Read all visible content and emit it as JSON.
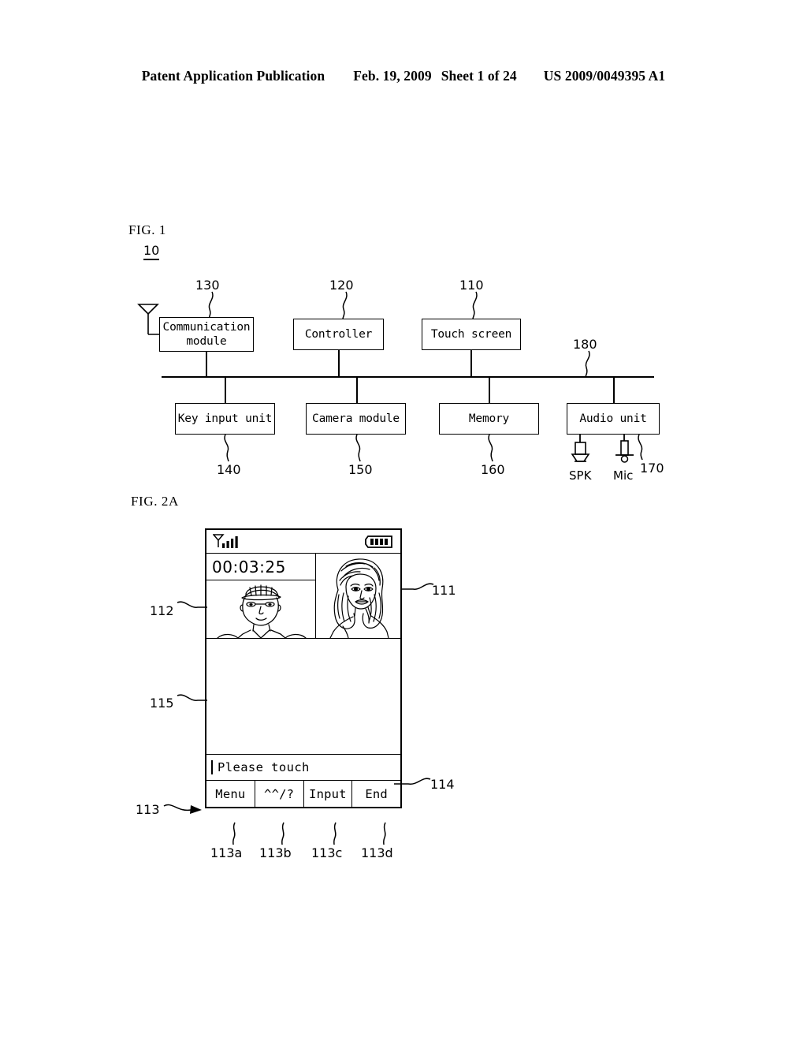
{
  "header": {
    "publication": "Patent Application Publication",
    "date": "Feb. 19, 2009",
    "sheet": "Sheet 1 of 24",
    "patent_number": "US 2009/0049395 A1"
  },
  "fig1": {
    "label": "FIG. 1",
    "device_ref": "10",
    "bus_ref": "180",
    "top_blocks": [
      {
        "ref": "130",
        "label": "Communication\nmodule",
        "line1": "Communication",
        "line2": "module"
      },
      {
        "ref": "120",
        "label": "Controller",
        "line1": "Controller",
        "line2": ""
      },
      {
        "ref": "110",
        "label": "Touch screen",
        "line1": "Touch screen",
        "line2": ""
      }
    ],
    "bottom_blocks": [
      {
        "ref": "140",
        "label": "Key input unit"
      },
      {
        "ref": "150",
        "label": "Camera module"
      },
      {
        "ref": "160",
        "label": "Memory"
      },
      {
        "ref": "170",
        "label": "Audio unit"
      }
    ],
    "audio_peripherals": [
      {
        "name": "speaker-icon",
        "label": "SPK"
      },
      {
        "name": "microphone-icon",
        "label": "Mic"
      }
    ],
    "antenna_icon": "antenna-icon"
  },
  "fig2a": {
    "label": "FIG. 2A",
    "refs": {
      "remote_view": "111",
      "self_view": "112",
      "softkey_bar": "113",
      "text_field": "114",
      "message_area": "115",
      "softkey_a": "113a",
      "softkey_b": "113b",
      "softkey_c": "113c",
      "softkey_d": "113d"
    },
    "status_bar": {
      "signal_icon": "signal-strength-icon",
      "signal_bars": 4,
      "battery_icon": "battery-icon",
      "battery_segments": 4
    },
    "call_timer": "00:03:25",
    "self_view_caption": "man-with-cap-portrait",
    "remote_view_caption": "woman-with-long-hair-portrait",
    "text_field_value": "Please touch",
    "softkeys": [
      {
        "label": "Menu"
      },
      {
        "label": "^^/?"
      },
      {
        "label": "Input"
      },
      {
        "label": "End"
      }
    ]
  },
  "colors": {
    "ink": "#000000",
    "paper": "#ffffff"
  }
}
